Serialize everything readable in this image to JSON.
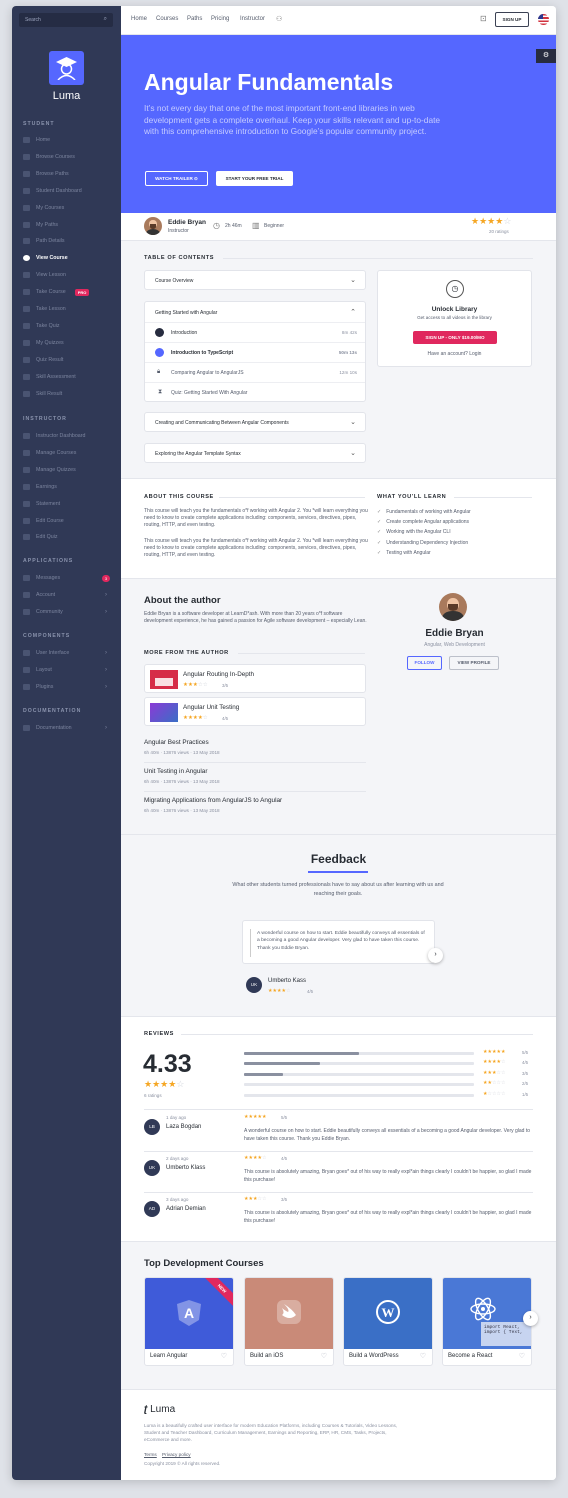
{
  "sidebar": {
    "search_placeholder": "Search",
    "brand": "Luma",
    "sections": {
      "student": "STUDENT",
      "instructor": "INSTRUCTOR",
      "applications": "APPLICATIONS",
      "components": "COMPONENTS",
      "documentation": "DOCUMENTATION"
    },
    "student_items": [
      "Home",
      "Browse Courses",
      "Browse Paths",
      "Student Dashboard",
      "My Courses",
      "My Paths",
      "Path Details",
      "View Course",
      "View Lesson",
      "Take Course",
      "Take Lesson",
      "Take Quiz",
      "My Quizzes",
      "Quiz Result",
      "Skill Assessment",
      "Skill Result"
    ],
    "pro_badge": "PRO",
    "instructor_items": [
      "Instructor Dashboard",
      "Manage Courses",
      "Manage Quizzes",
      "Earnings",
      "Statement",
      "Edit Course",
      "Edit Quiz"
    ],
    "application_items": [
      "Messages",
      "Account",
      "Community"
    ],
    "messages_count": "3",
    "component_items": [
      "User Interface",
      "Layout",
      "Plugins"
    ],
    "documentation_items": [
      "Documentation"
    ]
  },
  "topnav": {
    "links": [
      "Home",
      "Courses",
      "Paths",
      "Pricing",
      "Instructor"
    ],
    "signup": "SIGN UP"
  },
  "hero": {
    "title": "Angular Fundamentals",
    "description": "It’s not every day that one of the most important front-end libraries in web development gets a complete overhaul. Keep your skills relevant and up-to-date with this comprehensive introduction to Google’s popular community project.",
    "watch_trailer": "WATCH TRAILER",
    "free_trial": "START YOUR FREE TRIAL"
  },
  "course_meta": {
    "instructor_name": "Eddie Bryan",
    "instructor_role": "Instructor",
    "duration": "2h 46m",
    "level": "Beginner",
    "rating": 4,
    "ratings_count": "20 ratings"
  },
  "toc": {
    "heading": "TABLE OF CONTENTS",
    "overview": "Course Overview",
    "getting_started": "Getting Started with Angular",
    "lessons": [
      {
        "title": "Introduction",
        "time": "8m 42s"
      },
      {
        "title": "Introduction to TypeScript",
        "time": "50m 13s"
      },
      {
        "title": "Comparing Angular to AngularJS",
        "time": "12m 10s"
      },
      {
        "title": "Quiz: Getting Started With Angular",
        "time": ""
      }
    ],
    "sections_collapsed": [
      "Creating and Communicating Between Angular Components",
      "Exploring the Angular Template Syntax"
    ]
  },
  "unlock": {
    "title": "Unlock Library",
    "subtitle": "Get access to all videos in the library",
    "button": "SIGN UP - ONLY $19.00/MO",
    "login": "Have an account? Login"
  },
  "about": {
    "heading": "ABOUT THIS COURSE",
    "p1": "This course will teach you the fundamentals o*f working with Angular 2. You *will learn everything you need to know to create complete applications including: components, services, directives, pipes, routing, HTTP, and even testing.",
    "p2": "This course will teach you the fundamentals o*f working with Angular 2. You *will learn everything you need to know to create complete applications including: components, services, directives, pipes, routing, HTTP, and even testing."
  },
  "learn": {
    "heading": "WHAT YOU’LL LEARN",
    "items": [
      "Fundamentals of working with Angular",
      "Create complete Angular applications",
      "Working with the Angular CLI",
      "Understanding Dependency Injection",
      "Testing with Angular"
    ]
  },
  "author": {
    "heading": "About the author",
    "bio": "Eddie Bryan is a software developer at LearnD*ash. With more than 20 years o*f software development experience, he has gained a passion for Agile software development – especially Lean.",
    "name": "Eddie Bryan",
    "role": "Angular, Web Development",
    "follow": "FOLLOW",
    "view_profile": "VIEW PROFILE",
    "more_heading": "MORE FROM THE AUTHOR",
    "cards": [
      {
        "title": "Angular Routing In-Depth",
        "rating": 3,
        "score": "3/5"
      },
      {
        "title": "Angular Unit Testing",
        "rating": 4,
        "score": "4/5"
      }
    ],
    "list": [
      {
        "title": "Angular Best Practices",
        "meta": "6h 40m · 13876 views · 13 May 2018"
      },
      {
        "title": "Unit Testing in Angular",
        "meta": "6h 40m · 13876 views · 13 May 2018"
      },
      {
        "title": "Migrating Applications from AngularJS to Angular",
        "meta": "6h 40m · 13876 views · 13 May 2018"
      }
    ]
  },
  "feedback": {
    "title": "Feedback",
    "subtitle": "What other students turned professionals have to say about us after learning with us and reaching their goals.",
    "quote": "A wonderful course on how to start. Eddie beautifully conveys all essentials of a becoming a good Angular developer. Very glad to have taken this course. Thank you Eddie Bryan.",
    "name": "Umberto Kass",
    "initials": "UK",
    "rating": 4,
    "score": "4/5"
  },
  "reviews": {
    "heading": "REVIEWS",
    "average": "4.33",
    "average_stars": 4,
    "count": "6 ratings",
    "distribution": [
      {
        "stars": 5,
        "fraction": 0.5,
        "label": "5/5"
      },
      {
        "stars": 4,
        "fraction": 0.33,
        "label": "4/5"
      },
      {
        "stars": 3,
        "fraction": 0.17,
        "label": "3/5"
      },
      {
        "stars": 2,
        "fraction": 0,
        "label": "2/5"
      },
      {
        "stars": 1,
        "fraction": 0,
        "label": "1/5"
      }
    ],
    "items": [
      {
        "initials": "LB",
        "when": "1 day ago",
        "name": "Laza Bogdan",
        "rating": 5,
        "score": "5/5",
        "text": "A wonderful course on how to start. Eddie beautifully conveys all essentials of a becoming a good Angular developer. Very glad to have taken this course. Thank you Eddie Bryan."
      },
      {
        "initials": "UK",
        "when": "2 days ago",
        "name": "Umberto Klass",
        "rating": 4,
        "score": "4/5",
        "text": "This course is absolutely amazing, Bryan goes* out of his way to really expl*ain things clearly I couldn’t be happier, so glad I made this purchase!"
      },
      {
        "initials": "AD",
        "when": "3 days ago",
        "name": "Adrian Demian",
        "rating": 3,
        "score": "3/5",
        "text": "This course is absolutely amazing, Bryan goes* out of his way to really expl*ain things clearly I couldn’t be happier, so glad I made this purchase!"
      }
    ]
  },
  "top_courses": {
    "heading": "Top Development Courses",
    "items": [
      {
        "title": "Learn Angular",
        "color": "#3f5bd9",
        "badge": "NEW"
      },
      {
        "title": "Build an iOS",
        "color": "#c98a78",
        "badge": ""
      },
      {
        "title": "Build a WordPress",
        "color": "#3a6fc6",
        "badge": ""
      },
      {
        "title": "Become a React",
        "color": "#4a78d6",
        "badge": ""
      }
    ],
    "code_snippet": [
      "import React,",
      "import { Text,"
    ]
  },
  "footer": {
    "brand": "Luma",
    "text": "Luma is a beautifully crafted user interface for modern Education Platforms, including Courses & Tutorials, Video Lessons, Student and Teacher Dashboard, Curriculum Management, Earnings and Reporting, ERP, HR, CMS, Tasks, Projects, eCommerce and more.",
    "terms": "Terms",
    "privacy": "Privacy policy",
    "copyright": "Copyright 2019 © All rights reserved."
  },
  "colors": {
    "primary": "#5567ff",
    "sidebar": "#303956",
    "accent": "#e0285e",
    "star": "#f5a623"
  }
}
